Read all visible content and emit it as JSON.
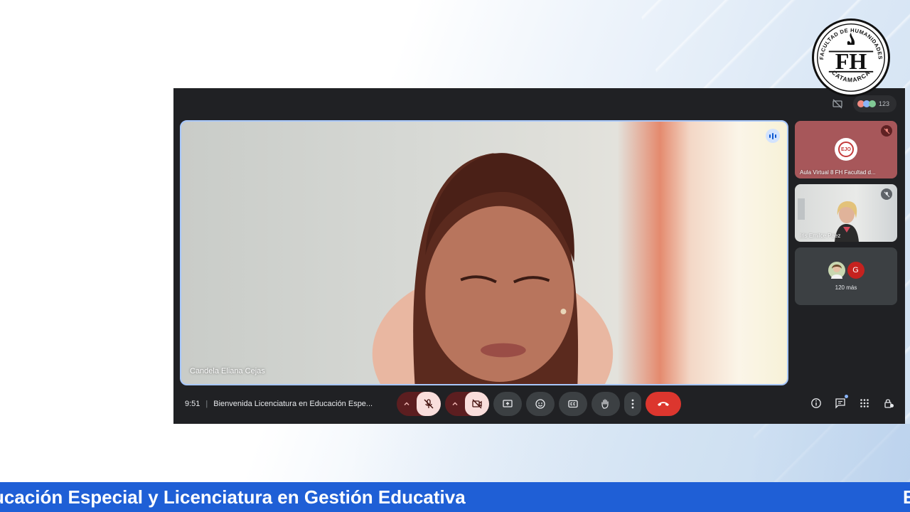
{
  "logo": {
    "top_text": "FACULTAD DE HUMANIDADES",
    "bottom_text": "CATAMARCA",
    "monogram": "FH"
  },
  "meet": {
    "participants_count": "123",
    "main_speaker": {
      "name": "Candela Eliana Cejas"
    },
    "side_tiles": [
      {
        "label": "Aula Virtual 8 FH Facultad d...",
        "avatar_text": "EJO"
      },
      {
        "label": "Iris Emilce Paez"
      },
      {
        "avatar_letter": "G",
        "label": "120 más"
      }
    ],
    "bottom_bar": {
      "time": "9:51",
      "separator": "|",
      "meeting_title": "Bienvenida Licenciatura en Educación Espe..."
    }
  },
  "ticker": {
    "text": "ucación Especial y Licenciatura en Gestión Educativa",
    "text_tail": "E"
  },
  "colors": {
    "ticker_bg": "#1f5fd6",
    "meet_bg": "#202124",
    "end_call": "#dc362e",
    "speaking_border": "#a8c7fa"
  }
}
